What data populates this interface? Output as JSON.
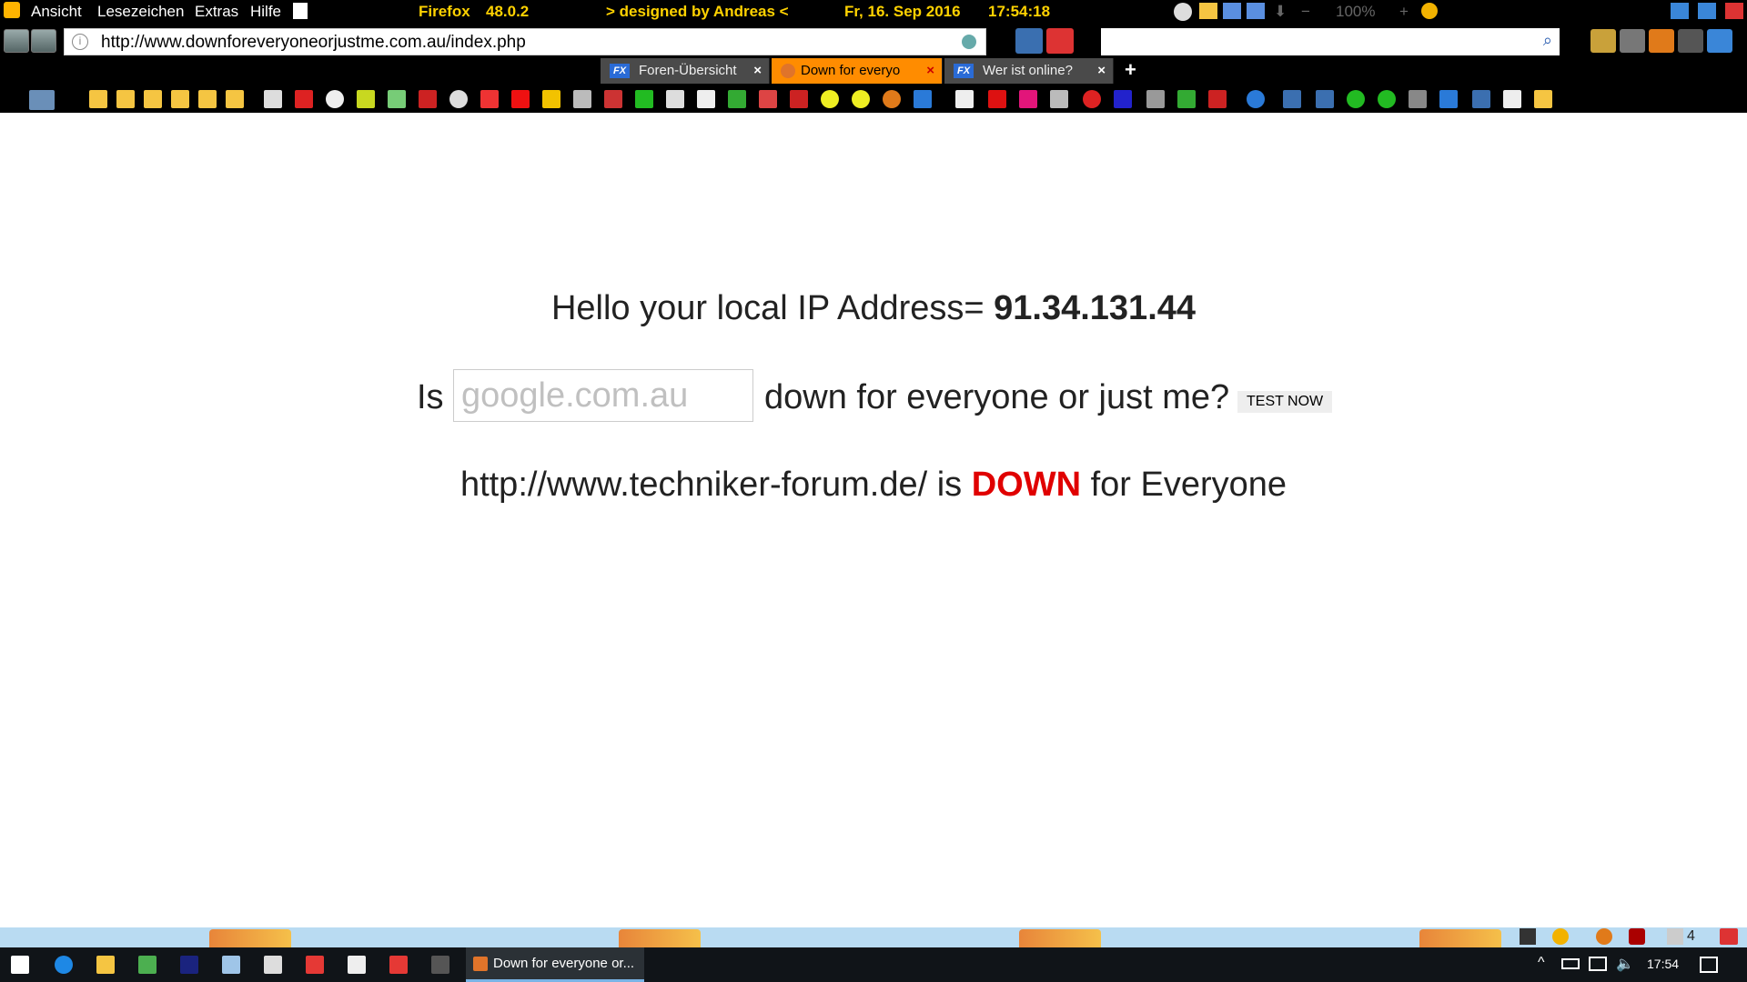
{
  "menu": {
    "items": [
      "Ansicht",
      "Lesezeichen",
      "Extras",
      "Hilfe"
    ],
    "browser_name": "Firefox",
    "browser_version": "48.0.2",
    "designed_by": "> designed by Andreas <",
    "date": "Fr, 16. Sep 2016",
    "time": "17:54:18",
    "zoom": "100%"
  },
  "address_bar": {
    "url": "http://www.downforeveryoneorjustme.com.au/index.php",
    "search_value": ""
  },
  "tabs": [
    {
      "label": "Foren-Übersicht",
      "active": false
    },
    {
      "label": "Down for everyo",
      "active": true
    },
    {
      "label": "Wer ist online?",
      "active": false
    }
  ],
  "page": {
    "hello_prefix": "Hello your local IP Address=",
    "ip": "91.34.131.44",
    "is_label": "Is",
    "input_placeholder": "google.com.au",
    "question": "down for everyone or just me?",
    "test_button": "TEST NOW",
    "result_url": "http://www.techniker-forum.de/ is",
    "result_status": "DOWN",
    "result_suffix": "for Everyone"
  },
  "taskbar": {
    "active_task": "Down for everyone or...",
    "clock": "17:54",
    "mail_count": "4"
  },
  "colors": {
    "accent_yellow": "#ffd200",
    "active_tab": "#ff8c00",
    "down_red": "#e00000"
  }
}
